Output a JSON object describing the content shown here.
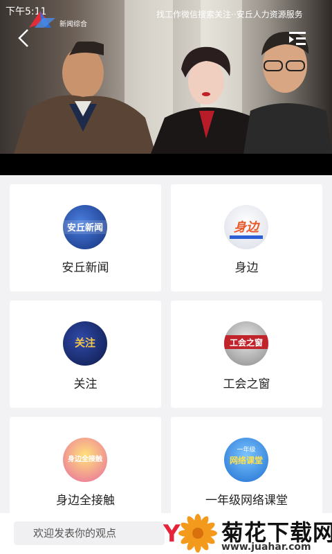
{
  "status": {
    "time": "下午5:11",
    "marquee": "找工作微信搜索关注··安丘人力资源服务"
  },
  "player": {
    "channel_name": "新闻综合"
  },
  "channels": [
    {
      "label": "安丘新闻",
      "thumb_text": "安丘新闻",
      "thumb_color": "#1c3f9a"
    },
    {
      "label": "身边",
      "thumb_text": "身边",
      "thumb_color": "#e85a2a"
    },
    {
      "label": "关注",
      "thumb_text": "关注",
      "thumb_color": "#1b2f7a"
    },
    {
      "label": "工会之窗",
      "thumb_text": "工会之窗",
      "thumb_color": "#b8232a"
    },
    {
      "label": "身边全接触",
      "thumb_text": "身边全接触",
      "thumb_color": "#e8417a"
    },
    {
      "label": "一年级网络课堂",
      "thumb_text": "网络课堂",
      "thumb_subtext": "一年级",
      "thumb_color": "#2c8be8"
    }
  ],
  "comment": {
    "placeholder": "欢迎发表你的观点"
  },
  "watermark": {
    "title": "菊花下载网",
    "url": "www.juahar.com"
  }
}
